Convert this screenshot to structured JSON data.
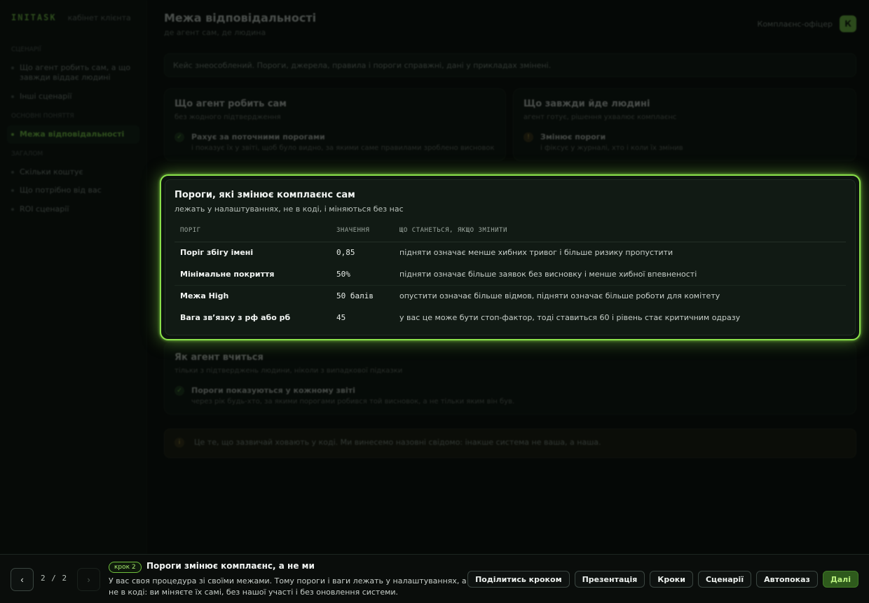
{
  "sidebar": {
    "brand": "INITASK",
    "brand_sub": "кабінет клієнта",
    "sections": [
      {
        "title": "СЦЕНАРІЇ",
        "items": [
          {
            "label": "Що агент робить сам, а що завжди віддає людині",
            "tail": ""
          },
          {
            "label": "Інші сценарії",
            "tail": ""
          }
        ]
      },
      {
        "title": "ОСНОВНІ ПОНЯТТЯ",
        "items": [
          {
            "label": "Межа відповідальності",
            "tail": ""
          }
        ]
      },
      {
        "title": "ЗАГАЛОМ",
        "items": [
          {
            "label": "Скільки коштує",
            "tail": ""
          },
          {
            "label": "Що потрібно від вас",
            "tail": ""
          },
          {
            "label": "ROI сценарії",
            "tail": ""
          }
        ]
      }
    ]
  },
  "header": {
    "title": "Межа відповідальності",
    "subtitle": "де агент сам, де людина",
    "user_name": "Комплаєнс-офіцер",
    "avatar_letter": "К"
  },
  "banner": "Кейс знеособлений. Пороги, джерела, правила і пороги справжні, дані у прикладах змінені.",
  "cards": {
    "agent_self": {
      "title": "Що агент робить сам",
      "subtitle": "без жодного підтвердження",
      "item_title": "Рахує за поточними порогами",
      "item_desc": "і показує їх у звіті, щоб було видно, за якими саме правилами зроблено висновок"
    },
    "to_human": {
      "title": "Що завжди йде людині",
      "subtitle": "агент готує, рішення ухвалює комплаєнс",
      "item_title": "Змінює пороги",
      "item_desc": "і фіксує у журналі, хто і коли їх змінив"
    },
    "learns": {
      "title": "Як агент вчиться",
      "subtitle": "тільки з підтверджень людини, ніколи з випадкової підказки",
      "item_title": "Пороги показуються у кожному звіті",
      "item_desc": "через рік будь-хто, за якими порогами робився той висновок, а не тільки яким він був."
    }
  },
  "note": "Це те, що зазвичай ховають у коді. Ми винесемо назовні свідомо: інакше система не ваша, а наша.",
  "spotlight": {
    "title": "Пороги, які змінює комплаєнс сам",
    "subtitle": "лежать у налаштуваннях, не в коді, і міняються без нас",
    "columns": [
      "ПОРІГ",
      "ЗНАЧЕННЯ",
      "ЩО СТАНЕТЬСЯ, ЯКЩО ЗМІНИТИ"
    ],
    "rows": [
      {
        "name": "Поріг збігу імені",
        "value": "0,85",
        "effect": "підняти означає менше хибних тривог і більше ризику пропустити"
      },
      {
        "name": "Мінімальне покриття",
        "value": "50%",
        "effect": "підняти означає більше заявок без висновку і менше хибної впевненості"
      },
      {
        "name": "Межа High",
        "value": "50 балів",
        "effect": "опустити означає більше відмов, підняти означає більше роботи для комітету"
      },
      {
        "name": "Вага зв’язку з рф або рб",
        "value": "45",
        "effect": "у вас це може бути стоп-фактор, тоді ставиться 60 і рівень стає критичним одразу"
      }
    ]
  },
  "tour": {
    "prev_icon": "‹",
    "next_icon": "›",
    "counter": "2 / 2",
    "badge": "крок 2",
    "title": "Пороги змінює комплаєнс, а не ми",
    "body": "У вас своя процедура зі своїми межами. Тому пороги і ваги лежать у налаштуваннях, а не в коді: ви міняєте їх самі, без нашої участі і без оновлення системи.",
    "actions": {
      "share": "Поділитись кроком",
      "presentation": "Презентація",
      "steps": "Кроки",
      "scenarios": "Сценарії",
      "autoplay": "Автопоказ",
      "next": "Далі"
    }
  },
  "colors": {
    "accent": "#8ae04a",
    "background": "#050806",
    "primary_button": "#2e5a1c"
  }
}
